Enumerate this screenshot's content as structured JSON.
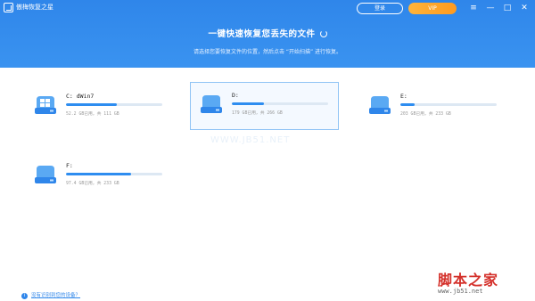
{
  "app": {
    "title": "傲梅恢复之星"
  },
  "header": {
    "login_label": "登录",
    "vip_label": "VIP",
    "title": "一键快速恢复您丢失的文件",
    "subtitle": "请选择您要恢复文件的位置，然后点击 “开始扫描” 进行恢复。"
  },
  "window_controls": {
    "menu": "≡",
    "minimize": "—",
    "maximize": "□",
    "close": "✕"
  },
  "drives": [
    {
      "name": "C: dWin7",
      "capacity": "52.2 GB已用，共 111 GB",
      "used_fraction": 0.53,
      "icon": "windows-drive-icon"
    },
    {
      "name": "D:",
      "capacity": "179 GB已用，共 266 GB",
      "used_fraction": 0.33,
      "icon": "drive-icon"
    },
    {
      "name": "E:",
      "capacity": "203 GB已用，共 233 GB",
      "used_fraction": 0.15,
      "icon": "drive-icon"
    },
    {
      "name": "F:",
      "capacity": "97.4 GB已用，共 233 GB",
      "used_fraction": 0.68,
      "icon": "drive-icon"
    }
  ],
  "watermark": "WWW.JB51.NET",
  "help": {
    "text": "没有识别到您的设备？"
  },
  "site": {
    "logo": "脚本之家",
    "url": "www.jb51.net"
  },
  "colors": {
    "accent": "#2f86ea",
    "vip": "#ff9a1f",
    "bar_track": "#dde8f3"
  }
}
